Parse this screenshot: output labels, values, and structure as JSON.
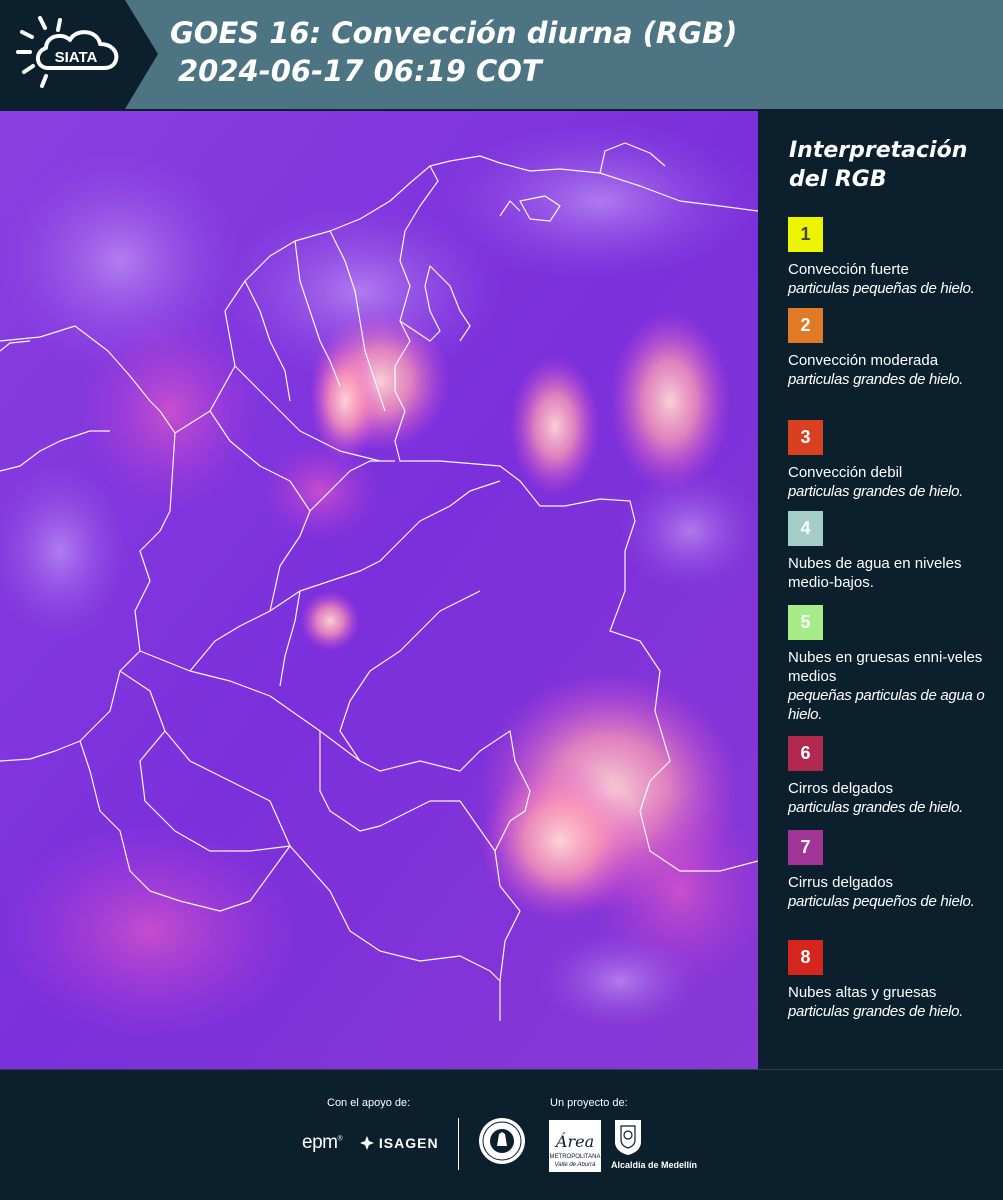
{
  "header": {
    "logo_text": "SIATA",
    "title_line1": "GOES 16: Convección diurna (RGB)",
    "title_line2": "2024-06-17 06:19 COT"
  },
  "legend": {
    "title_line1": "Interpretación",
    "title_line2": "del RGB",
    "items": [
      {
        "number": "1",
        "color": "#ecf400",
        "text_color": "#444444",
        "title": "Convección fuerte",
        "subtitle": "particulas pequeñas de hielo."
      },
      {
        "number": "2",
        "color": "#e07a24",
        "text_color": "#ffffff",
        "title": "Convección moderada",
        "subtitle": "particulas grandes de hielo."
      },
      {
        "number": "3",
        "color": "#d8401f",
        "text_color": "#ffffff",
        "title": "Convección debil",
        "subtitle": "particulas grandes de hielo."
      },
      {
        "number": "4",
        "color": "#a3cdc6",
        "text_color": "#ffffff",
        "title": "Nubes de agua en niveles medio-bajos.",
        "subtitle": ""
      },
      {
        "number": "5",
        "color": "#a6ec88",
        "text_color": "#ffffff",
        "title": "Nubes en gruesas enni-veles medios",
        "subtitle": "pequeñas particulas de agua o hielo."
      },
      {
        "number": "6",
        "color": "#b3284f",
        "text_color": "#ffffff",
        "title": "Cirros delgados",
        "subtitle": "particulas grandes de hielo."
      },
      {
        "number": "7",
        "color": "#a23598",
        "text_color": "#ffffff",
        "title": "Cirrus delgados",
        "subtitle": "particulas pequeños de hielo."
      },
      {
        "number": "8",
        "color": "#d5251d",
        "text_color": "#ffffff",
        "title": "Nubes altas y gruesas",
        "subtitle": "particulas grandes de hielo."
      }
    ]
  },
  "footer": {
    "support_label": "Con el apoyo de:",
    "project_label": "Un proyecto de:",
    "epm": "epm",
    "isagen": "ISAGEN",
    "metro_name": "Área",
    "metro_line1": "METROPOLITANA",
    "metro_line2": "Valle de Aburrá",
    "alcaldia": "Alcaldía de Medellín"
  }
}
